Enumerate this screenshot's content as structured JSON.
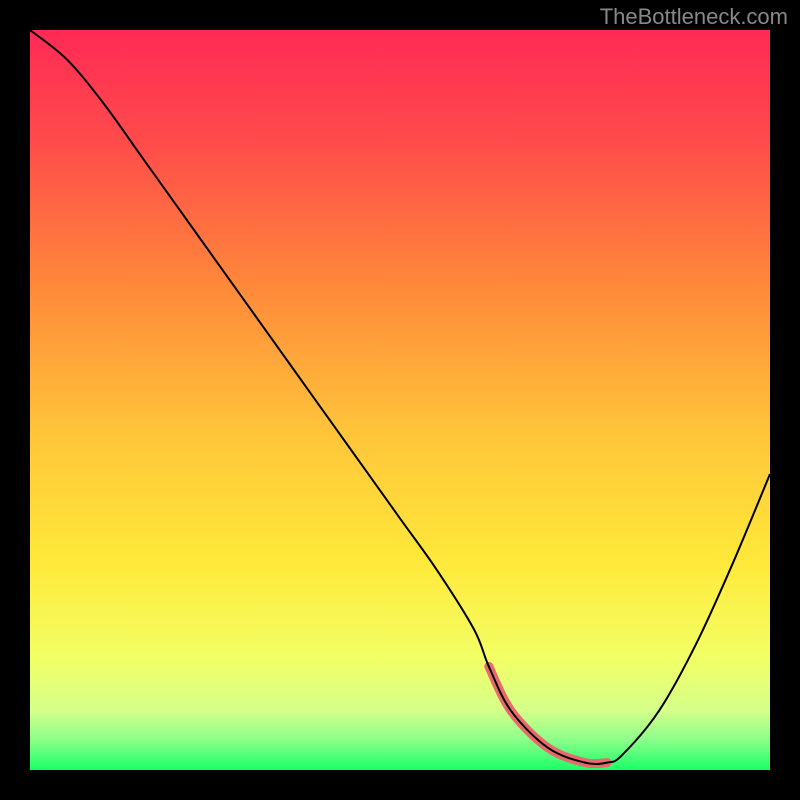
{
  "watermark": "TheBottleneck.com",
  "chart_data": {
    "type": "line",
    "title": "",
    "xlabel": "",
    "ylabel": "",
    "xlim": [
      0,
      100
    ],
    "ylim": [
      0,
      100
    ],
    "series": [
      {
        "name": "bottleneck-curve",
        "x": [
          0,
          5,
          10,
          15,
          20,
          25,
          30,
          35,
          40,
          45,
          50,
          55,
          60,
          62,
          65,
          70,
          75,
          78,
          80,
          85,
          90,
          95,
          100
        ],
        "values": [
          100,
          96,
          90,
          83,
          76,
          69,
          62,
          55,
          48,
          41,
          34,
          27,
          19,
          14,
          8,
          3,
          1,
          1,
          2,
          8,
          17,
          28,
          40
        ]
      }
    ],
    "highlight_range": {
      "x_start": 62,
      "x_end": 78
    },
    "gradient_stops": [
      {
        "offset": 0,
        "color": "#ff2a55"
      },
      {
        "offset": 15,
        "color": "#ff4b4b"
      },
      {
        "offset": 35,
        "color": "#ff8a3a"
      },
      {
        "offset": 55,
        "color": "#ffc63a"
      },
      {
        "offset": 72,
        "color": "#ffe93a"
      },
      {
        "offset": 85,
        "color": "#f2ff66"
      },
      {
        "offset": 92,
        "color": "#d4ff8a"
      },
      {
        "offset": 96,
        "color": "#8aff8a"
      },
      {
        "offset": 100,
        "color": "#1aff66"
      }
    ]
  }
}
